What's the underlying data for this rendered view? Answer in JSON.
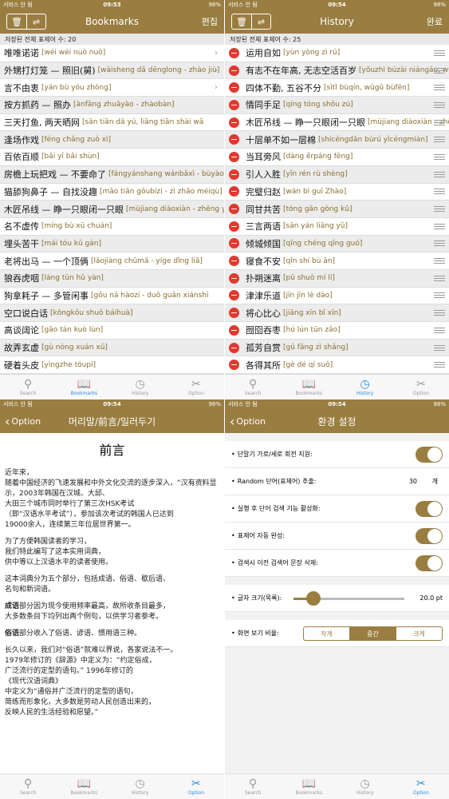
{
  "colors": {
    "accent": "#9a7d40",
    "tab_active": "#2a8cdf",
    "delete": "#e0392e"
  },
  "status": {
    "carrier": "서비스 안 됨",
    "t1": "09:53",
    "t2": "09:54",
    "t3": "09:54",
    "t4": "09:54",
    "battery": "98%"
  },
  "tabs": {
    "search": "Search",
    "bookmarks": "Bookmarks",
    "history": "History",
    "option": "Option"
  },
  "bookmarks": {
    "title": "Bookmarks",
    "edit": "편집",
    "count": "저장된 전체 표제어 수: 20",
    "rows": [
      {
        "hz": "唯唯诺诺",
        "py": "[wéi wéi nuò nuò]"
      },
      {
        "hz": "外甥打灯笼 — 照旧(舅)",
        "py": "[wàisheng dǎ dēnglong - zhào jiù]"
      },
      {
        "hz": "言不由衷",
        "py": "[yán bù yóu zhōng]"
      },
      {
        "hz": "按方抓药 — 照办",
        "py": "[ànfāng zhuāyào - zhàobàn]"
      },
      {
        "hz": "三天打鱼, 两天晒网",
        "py": "[sān tiān dǎ yú, liǎng tiān shài wǎ"
      },
      {
        "hz": "逢场作戏",
        "py": "[féng chǎng zuò xì]"
      },
      {
        "hz": "百依百顺",
        "py": "[bǎi yī bǎi shùn]"
      },
      {
        "hz": "房檐上玩把戏 — 不要命了",
        "py": "[fángyánshang wánbǎxì - bùyàomìng le]"
      },
      {
        "hz": "猫舔狗鼻子 — 自找没趣",
        "py": "[māo tiǎn gǒubízi - zì zhǎo méiqù]"
      },
      {
        "hz": "木匠吊线 — 睁一只眼闭一只眼",
        "py": "[mùjiang diàoxiàn - zhēng yìzhī yǎn bì yìzhī yǎn]"
      },
      {
        "hz": "名不虚传",
        "py": "[míng bù xū chuán]"
      },
      {
        "hz": "埋头苦干",
        "py": "[mái tóu kǔ gàn]"
      },
      {
        "hz": "老将出马 — 一个顶俩",
        "py": "[lǎojiàng chūmǎ - yíge dǐng liǎ]"
      },
      {
        "hz": "狼吞虎咽",
        "py": "[láng tūn hǔ yàn]"
      },
      {
        "hz": "狗拿耗子 — 多管闲事",
        "py": "[gǒu ná hàozi - duō guǎn xiánshì"
      },
      {
        "hz": "空口说白话",
        "py": "[kōngkǒu shuō báihuà]"
      },
      {
        "hz": "高谈阔论",
        "py": "[gāo tán kuò lùn]"
      },
      {
        "hz": "故弄玄虚",
        "py": "[gù nòng xuán xū]"
      },
      {
        "hz": "硬着头皮",
        "py": "[yìngzhe tóupí]"
      }
    ]
  },
  "history": {
    "title": "History",
    "done": "완료",
    "count": "저장된 전체 표제어 수: 25",
    "rows": [
      {
        "hz": "运用自如",
        "py": "[yùn yòng zì rú]"
      },
      {
        "hz": "有志不在年高, 无志空活百岁",
        "py": "[yǒuzhì búzài niángāo, wúzhì kōnghuó bǎisuì]"
      },
      {
        "hz": "四体不勤, 五谷不分",
        "py": "[sìtǐ bùqín, wǔgǔ bùfēn]"
      },
      {
        "hz": "情同手足",
        "py": "[qíng tóng shǒu zú]"
      },
      {
        "hz": "木匠吊线 — 睁一只眼闭一只眼",
        "py": "[mùjiang diàoxiàn - zhēng yìzhī yǎn bì yìzhī yǎn]"
      },
      {
        "hz": "十层单不如一层棉",
        "py": "[shícéngdān bùrú yìcéngmián]"
      },
      {
        "hz": "当耳旁风",
        "py": "[dàng ěrpáng fēng]"
      },
      {
        "hz": "引人入胜",
        "py": "[yǐn rén rù shèng]"
      },
      {
        "hz": "完璧归赵",
        "py": "[wán bì guī Zhào]"
      },
      {
        "hz": "同甘共苦",
        "py": "[tóng gān gòng kǔ]"
      },
      {
        "hz": "三言两语",
        "py": "[sān yán liǎng yǔ]"
      },
      {
        "hz": "倾城倾国",
        "py": "[qīng chéng qīng guó]"
      },
      {
        "hz": "寝食不安",
        "py": "[qǐn shí bù ān]"
      },
      {
        "hz": "扑朔迷离",
        "py": "[pū shuò mí lí]"
      },
      {
        "hz": "津津乐道",
        "py": "[jīn jīn lè dào]"
      },
      {
        "hz": "将心比心",
        "py": "[jiāng xīn bǐ xīn]"
      },
      {
        "hz": "囫囵吞枣",
        "py": "[hú lún tūn zǎo]"
      },
      {
        "hz": "孤芳自赏",
        "py": "[gū fāng zì shǎng]"
      },
      {
        "hz": "各得其所",
        "py": "[gè dé qí suǒ]"
      }
    ]
  },
  "preface": {
    "back": "Option",
    "title": "머리말/前言/일러두기",
    "heading": "前言",
    "p1": "近年来，\n随着中国经济的飞速发展和中外文化交流的逐步深入，“汉有资料显示，2003年韩国在汉城、大邱、\n大田三个城市同时举行了第三次HSK考试\n（即“汉语水平考试”），参加该次考试的韩国人已达到\n19000余人，连续第三年位居世界第一。",
    "p2": "为了方便韩国读者的学习，\n我们特此编写了这本实用词典，\n供中等以上汉语水平的读者使用。",
    "p3": "这本词典分为五个部分，包括成语、俗语、歇后语、\n名句和新词语。",
    "p4b": "成语",
    "p4": "部分因为现今使用频率最高，故所收条目最多，\n大多数条目下均列出两个例句，以供学习者参考。",
    "p5b": "俗语",
    "p5": "部分收入了俗语、谚语、惯用语三种。",
    "p6": "长久以来，我们对“俗语”就难以界说，各家说法不一。\n1979年修订的《辞源》中定义为：“约定俗成，\n广泛流行的定型的语句。” 1996年修订的\n《现代汉语词典》\n中定义为“通俗并广泛流行的定型的语句，\n简练而形象化，大多数是劳动人民创造出来的，\n反映人民的生活经验和愿望。”"
  },
  "settings": {
    "back": "Option",
    "title": "환경 설정",
    "rotate": "단말기 가로/세로 회전 지원:",
    "random": "Random 단어(표제어) 추출:",
    "random_val": "30",
    "random_unit": "개",
    "autosearch": "실행 후 단어 검색 기능 활성화:",
    "autocomplete": "표제어 자동 완성:",
    "clearprev": "검색시 이전 검색어 문장 삭제:",
    "fontsize": "글자 크기(목록):",
    "fontsize_val": "20.0 pt",
    "fontsize_level": 0.18,
    "ratio": "화면 보기 비율:",
    "ratio_small": "작게",
    "ratio_mid": "중간",
    "ratio_large": "크게"
  }
}
